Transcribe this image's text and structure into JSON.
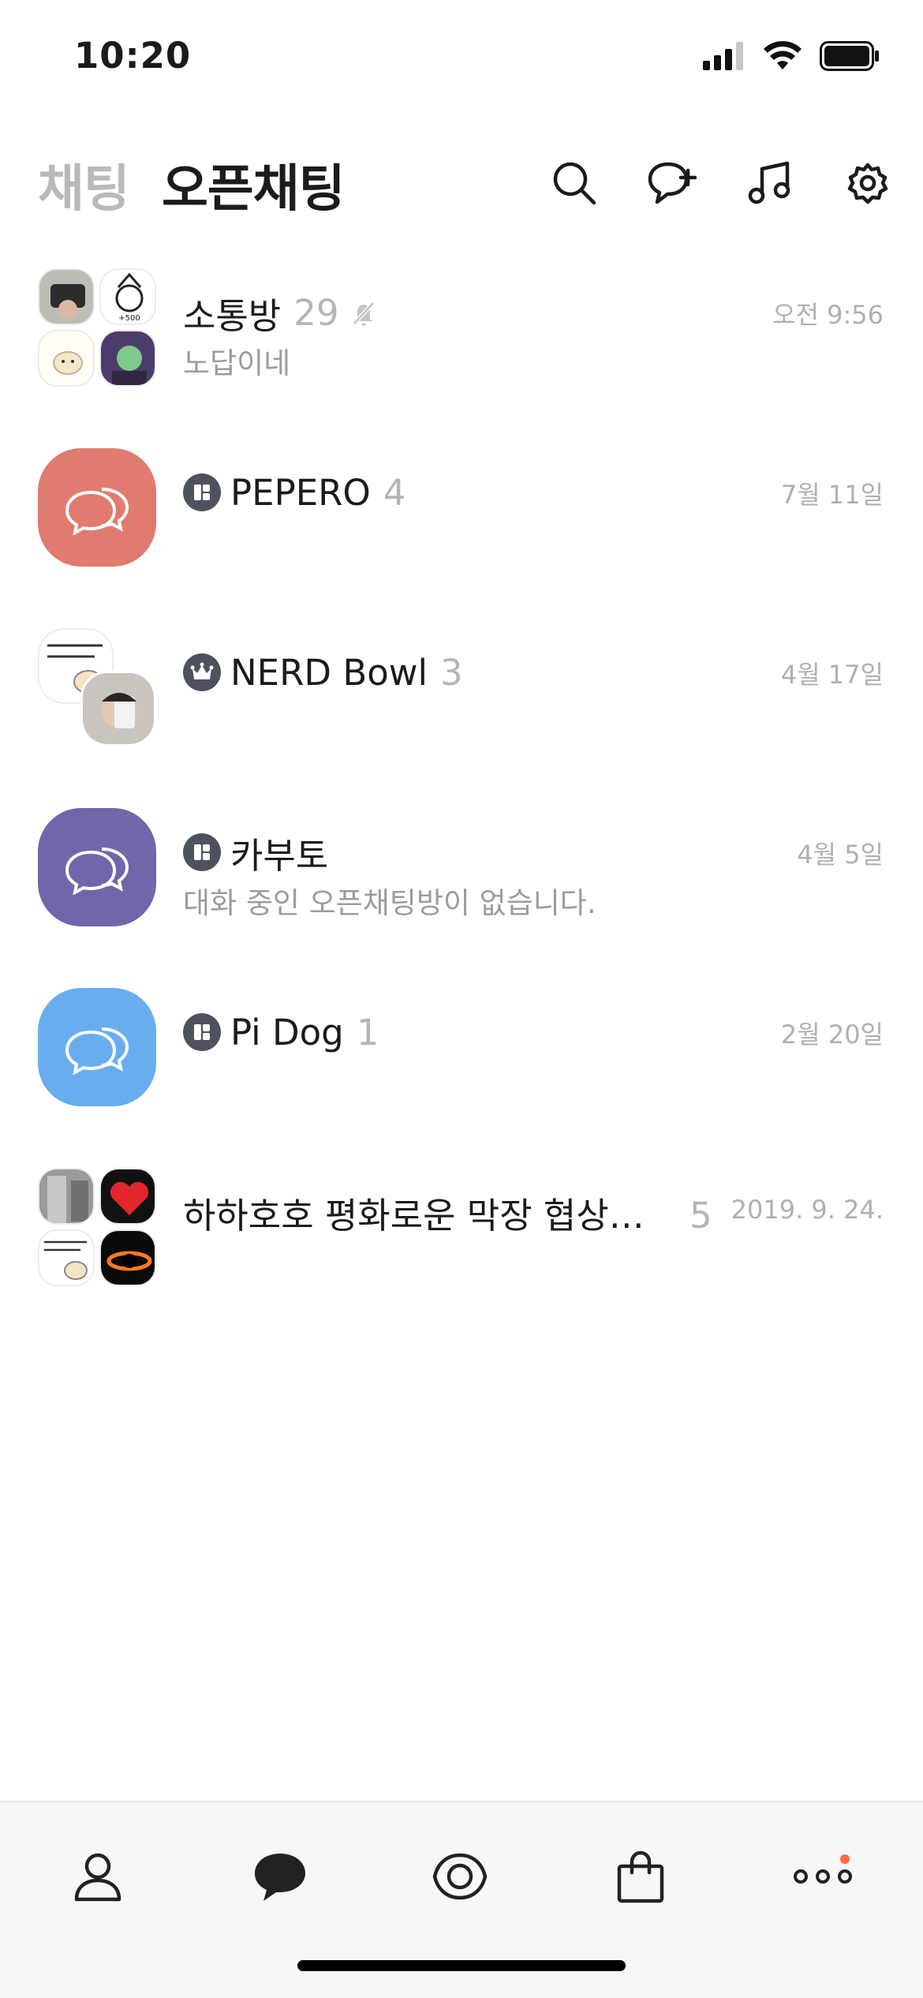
{
  "status_bar": {
    "time": "10:20"
  },
  "header": {
    "tabs": [
      {
        "label": "채팅",
        "active": false
      },
      {
        "label": "오픈채팅",
        "active": true
      }
    ],
    "icons": [
      "search-icon",
      "new-chat-icon",
      "music-icon",
      "settings-icon"
    ]
  },
  "chats": [
    {
      "title": "소통방",
      "count": "29",
      "muted": true,
      "preview": "노답이네",
      "time": "오전 9:56",
      "avatar": "group-grid",
      "badge": "none"
    },
    {
      "title": "PEPERO",
      "count": "4",
      "preview": "",
      "time": "7월 11일",
      "avatar": "default",
      "avatar_color": "#e07b6f",
      "badge": "host"
    },
    {
      "title": "NERD Bowl",
      "count": "3",
      "preview": "",
      "time": "4월 17일",
      "avatar": "group-duo",
      "badge": "crown"
    },
    {
      "title": "카부토",
      "count": "",
      "preview": "대화 중인 오픈채팅방이 없습니다.",
      "time": "4월 5일",
      "avatar": "default",
      "avatar_color": "#7265a9",
      "badge": "host"
    },
    {
      "title": "Pi Dog",
      "count": "1",
      "preview": "",
      "time": "2월 20일",
      "avatar": "default",
      "avatar_color": "#68aeef",
      "badge": "host"
    },
    {
      "title": "하하호호 평화로운 막장 협상…",
      "count": "5",
      "preview": "",
      "time": "2019. 9. 24.",
      "avatar": "group-grid",
      "badge": "none"
    }
  ],
  "tab_bar": {
    "items": [
      "friends-icon",
      "chats-icon",
      "view-icon",
      "shopping-icon",
      "more-icon"
    ],
    "active": "chats-icon",
    "more_has_notification": true
  },
  "colors": {
    "accent_dot": "#ff6b3d",
    "badge": "#4d525c",
    "muted_text": "#b5b5b5"
  }
}
